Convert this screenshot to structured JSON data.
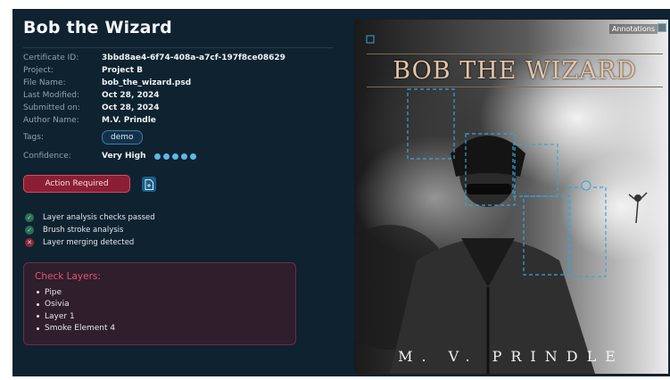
{
  "app": {
    "title": "Bob the Wizard"
  },
  "details": {
    "certificate_id": {
      "label": "Certificate ID:",
      "value": "3bbd8ae4-6f74-408a-a7cf-197f8ce08629"
    },
    "project": {
      "label": "Project:",
      "value": "Project B"
    },
    "file_name": {
      "label": "File Name:",
      "value": "bob_the_wizard.psd"
    },
    "last_modified": {
      "label": "Last Modified:",
      "value": "Oct 28, 2024"
    },
    "submitted_on": {
      "label": "Submitted on:",
      "value": "Oct 28, 2024"
    },
    "author_name": {
      "label": "Author Name:",
      "value": "M.V. Prindle"
    },
    "tags": {
      "label": "Tags:",
      "items": [
        "demo"
      ]
    },
    "confidence": {
      "label": "Confidence:",
      "value": "Very High",
      "level": 5,
      "max": 5
    }
  },
  "actions": {
    "action_required_label": "Action Required",
    "file_icon": "file-plus-icon"
  },
  "checks": [
    {
      "label": "Layer analysis checks passed",
      "status": "pass",
      "icon": "check-circle-icon"
    },
    {
      "label": "Brush stroke analysis",
      "status": "pass",
      "icon": "check-circle-icon"
    },
    {
      "label": "Layer merging detected",
      "status": "fail",
      "icon": "x-circle-icon"
    }
  ],
  "layers_box": {
    "title": "Check Layers:",
    "items": [
      "Pipe",
      "Osivia",
      "Layer 1",
      "Smoke Element 4"
    ]
  },
  "cover": {
    "annotations_label": "Annotations",
    "title_text": "BOB THE WIZARD",
    "author_text": "M. V. PRINDLE"
  },
  "colors": {
    "background": "#0f2230",
    "accent": "#5fb7e6",
    "danger": "#8a1f33",
    "danger_text": "#e25570",
    "success": "#2d6e54"
  }
}
